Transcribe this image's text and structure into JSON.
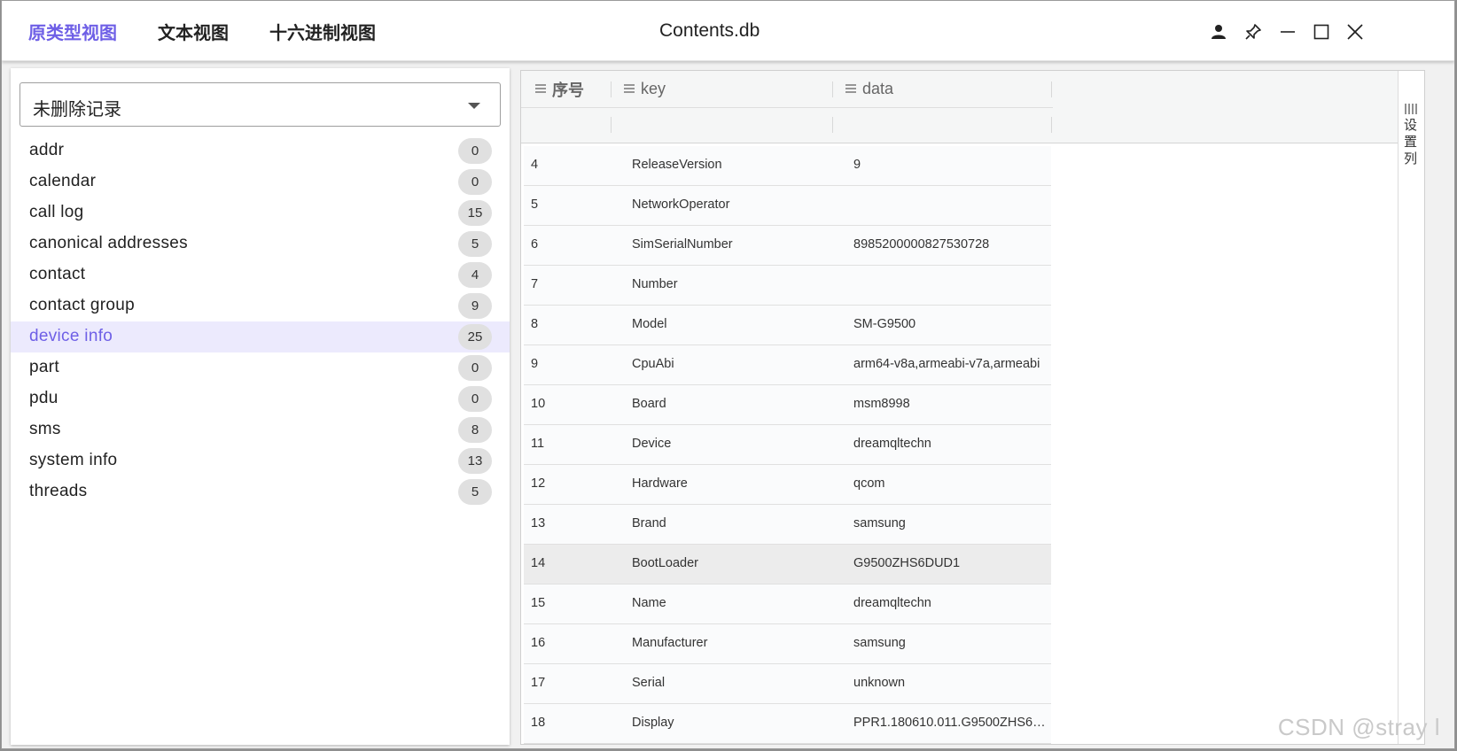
{
  "titlebar": {
    "tabs": [
      {
        "label": "原类型视图",
        "active": true
      },
      {
        "label": "文本视图",
        "active": false
      },
      {
        "label": "十六进制视图",
        "active": false
      }
    ],
    "title": "Contents.db"
  },
  "filter": {
    "selected": "未删除记录"
  },
  "tables": [
    {
      "name": "addr",
      "count": "0"
    },
    {
      "name": "calendar",
      "count": "0"
    },
    {
      "name": "call log",
      "count": "15"
    },
    {
      "name": "canonical addresses",
      "count": "5"
    },
    {
      "name": "contact",
      "count": "4"
    },
    {
      "name": "contact group",
      "count": "9"
    },
    {
      "name": "device info",
      "count": "25"
    },
    {
      "name": "part",
      "count": "0"
    },
    {
      "name": "pdu",
      "count": "0"
    },
    {
      "name": "sms",
      "count": "8"
    },
    {
      "name": "system info",
      "count": "13"
    },
    {
      "name": "threads",
      "count": "5"
    }
  ],
  "selected_table": "device info",
  "grid": {
    "columns": [
      "序号",
      "key",
      "data"
    ],
    "rows": [
      [
        "4",
        "ReleaseVersion",
        "9"
      ],
      [
        "5",
        "NetworkOperator",
        ""
      ],
      [
        "6",
        "SimSerialNumber",
        "8985200000827530728"
      ],
      [
        "7",
        "Number",
        ""
      ],
      [
        "8",
        "Model",
        "SM-G9500"
      ],
      [
        "9",
        "CpuAbi",
        "arm64-v8a,armeabi-v7a,armeabi"
      ],
      [
        "10",
        "Board",
        "msm8998"
      ],
      [
        "11",
        "Device",
        "dreamqltechn"
      ],
      [
        "12",
        "Hardware",
        "qcom"
      ],
      [
        "13",
        "Brand",
        "samsung"
      ],
      [
        "14",
        "BootLoader",
        "G9500ZHS6DUD1"
      ],
      [
        "15",
        "Name",
        "dreamqltechn"
      ],
      [
        "16",
        "Manufacturer",
        "samsung"
      ],
      [
        "17",
        "Serial",
        "unknown"
      ],
      [
        "18",
        "Display",
        "PPR1.180610.011.G9500ZHS6D..."
      ]
    ],
    "highlighted_row": "14"
  },
  "settings_column_label": "设置列",
  "watermark": "CSDN @stray l",
  "colors": {
    "accent": "#6e5fe6",
    "selected_bg": "#eceafd"
  }
}
